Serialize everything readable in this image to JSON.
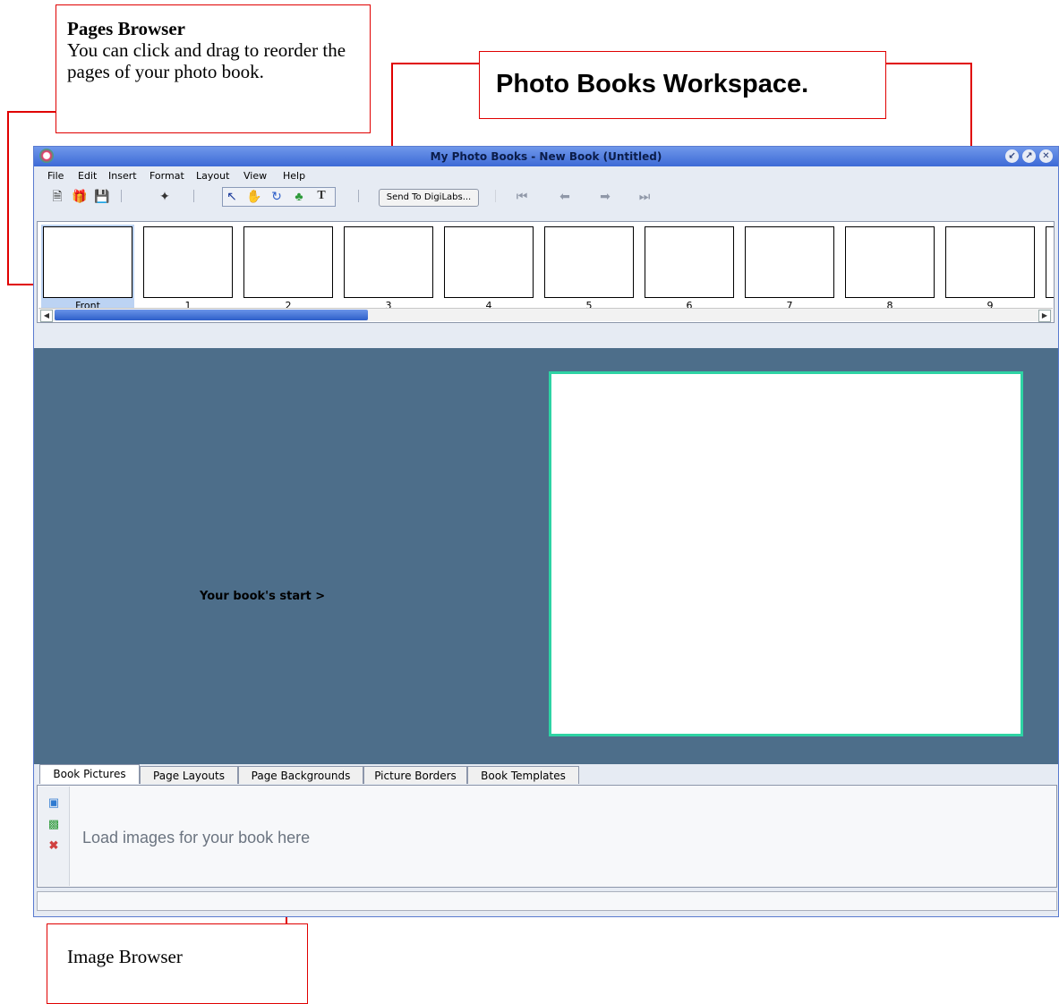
{
  "callouts": {
    "pages_browser": {
      "title": "Pages Browser",
      "text": "You can click and drag to reorder the pages of your photo book."
    },
    "workspace": "Photo Books Workspace.",
    "image_browser": "Image Browser"
  },
  "window": {
    "title": "My Photo Books - New Book (Untitled)",
    "controls": [
      "minimize-icon",
      "maximize-icon",
      "close-icon"
    ]
  },
  "menu": [
    "File",
    "Edit",
    "Insert",
    "Format",
    "Layout",
    "View",
    "Help"
  ],
  "toolbar": {
    "icons": [
      "new-document-icon",
      "open-book-icon",
      "save-icon",
      "magic-wand-icon",
      "select-arrow-icon",
      "hand-pan-icon",
      "rotate-icon",
      "add-picture-icon",
      "add-text-icon",
      "first-page-icon",
      "previous-page-icon",
      "next-page-icon",
      "last-page-icon"
    ],
    "send_label": "Send To DigiLabs..."
  },
  "pages": [
    "Front",
    "1",
    "2",
    "3",
    "4",
    "5",
    "6",
    "7",
    "8",
    "9"
  ],
  "selected_page": "Front",
  "workspace": {
    "book_start": "Your book's start >"
  },
  "tabs": [
    "Book Pictures",
    "Page Layouts",
    "Page Backgrounds",
    "Picture Borders",
    "Book Templates"
  ],
  "active_tab": "Book Pictures",
  "image_panel": {
    "hint": "Load images for your book here",
    "icons": [
      "add-image-icon",
      "import-image-icon",
      "remove-image-icon"
    ]
  },
  "colors": {
    "workspace_bg": "#4d6e8a",
    "canvas_border": "#2ed3a4",
    "callout_red": "#e00000",
    "titlebar": "#3d6ad6"
  }
}
